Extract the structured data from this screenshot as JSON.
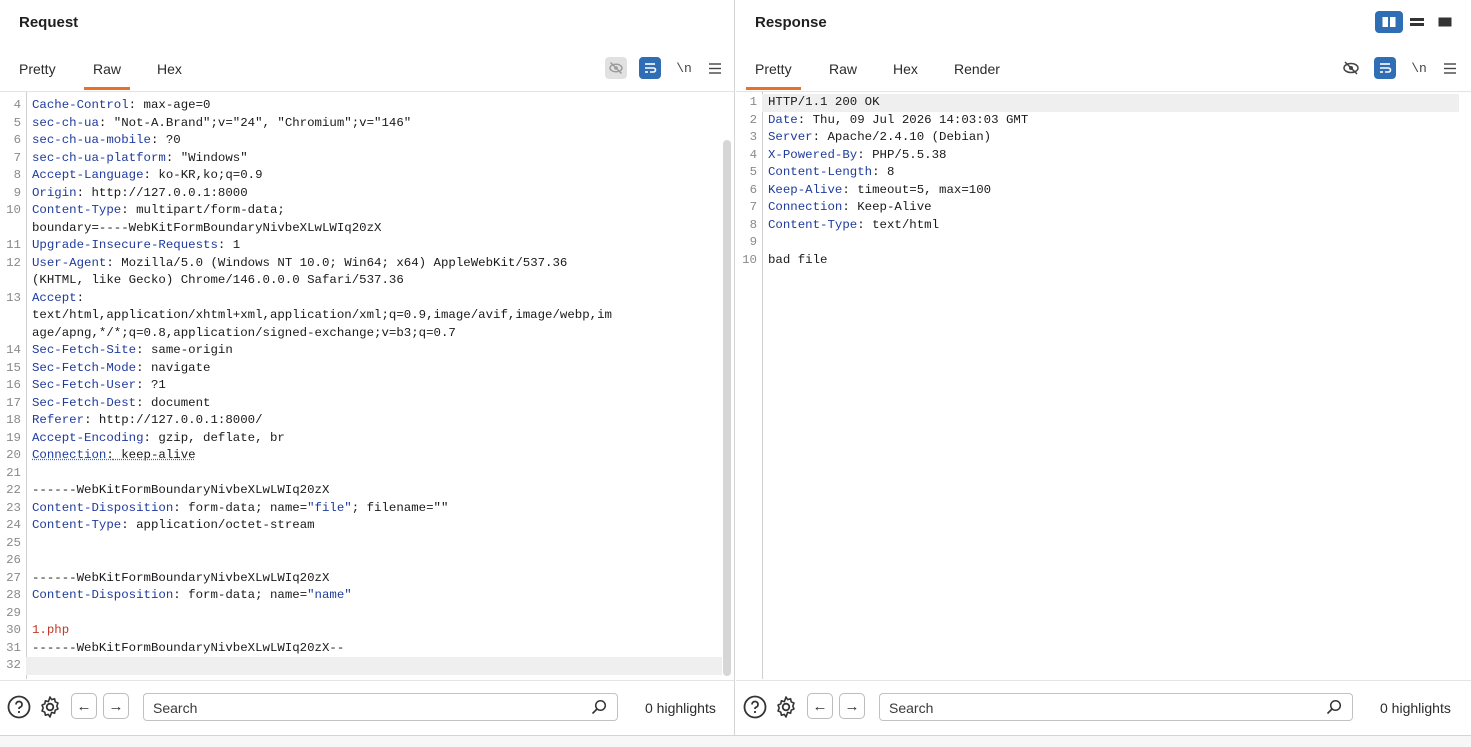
{
  "request": {
    "title": "Request",
    "tabs": [
      {
        "label": "Pretty"
      },
      {
        "label": "Raw",
        "active": true
      },
      {
        "label": "Hex"
      }
    ],
    "newline_label": "\\n",
    "lines": [
      {
        "n": "4",
        "k": "Cache-Control",
        "v": " max-age=0"
      },
      {
        "n": "5",
        "k": "sec-ch-ua",
        "v": " \"Not-A.Brand\";v=\"24\", \"Chromium\";v=\"146\""
      },
      {
        "n": "6",
        "k": "sec-ch-ua-mobile",
        "v": " ?0"
      },
      {
        "n": "7",
        "k": "sec-ch-ua-platform",
        "v": " \"Windows\""
      },
      {
        "n": "8",
        "k": "Accept-Language",
        "v": " ko-KR,ko;q=0.9"
      },
      {
        "n": "9",
        "k": "Origin",
        "v": " http://127.0.0.1:8000"
      },
      {
        "n": "10",
        "k": "Content-Type",
        "v": " multipart/form-data;"
      },
      {
        "n": "",
        "t": "boundary=----WebKitFormBoundaryNivbeXLwLWIq20zX"
      },
      {
        "n": "11",
        "k": "Upgrade-Insecure-Requests",
        "v": " 1"
      },
      {
        "n": "12",
        "k": "User-Agent",
        "v": " Mozilla/5.0 (Windows NT 10.0; Win64; x64) AppleWebKit/537.36"
      },
      {
        "n": "",
        "t": "(KHTML, like Gecko) Chrome/146.0.0.0 Safari/537.36"
      },
      {
        "n": "13",
        "k": "Accept",
        "v": ""
      },
      {
        "n": "",
        "t": "text/html,application/xhtml+xml,application/xml;q=0.9,image/avif,image/webp,im"
      },
      {
        "n": "",
        "t": "age/apng,*/*;q=0.8,application/signed-exchange;v=b3;q=0.7"
      },
      {
        "n": "14",
        "k": "Sec-Fetch-Site",
        "v": " same-origin"
      },
      {
        "n": "15",
        "k": "Sec-Fetch-Mode",
        "v": " navigate"
      },
      {
        "n": "16",
        "k": "Sec-Fetch-User",
        "v": " ?1"
      },
      {
        "n": "17",
        "k": "Sec-Fetch-Dest",
        "v": " document"
      },
      {
        "n": "18",
        "k": "Referer",
        "v": " http://127.0.0.1:8000/"
      },
      {
        "n": "19",
        "k": "Accept-Encoding",
        "v": " gzip, deflate, br"
      },
      {
        "n": "20",
        "k": "Connection",
        "v": " keep-alive",
        "dotted": true
      },
      {
        "n": "21",
        "t": ""
      },
      {
        "n": "22",
        "t": "------WebKitFormBoundaryNivbeXLwLWIq20zX"
      },
      {
        "n": "23",
        "k": "Content-Disposition",
        "v": " form-data; name=",
        "s": "\"file\"",
        "v2": "; filename=\"\""
      },
      {
        "n": "24",
        "k": "Content-Type",
        "v": " application/octet-stream"
      },
      {
        "n": "25",
        "t": ""
      },
      {
        "n": "26",
        "t": ""
      },
      {
        "n": "27",
        "t": "------WebKitFormBoundaryNivbeXLwLWIq20zX"
      },
      {
        "n": "28",
        "k": "Content-Disposition",
        "v": " form-data; name=",
        "s": "\"name\"",
        "v2": ""
      },
      {
        "n": "29",
        "t": ""
      },
      {
        "n": "30",
        "t": "1.php",
        "red": true
      },
      {
        "n": "31",
        "t": "------WebKitFormBoundaryNivbeXLwLWIq20zX--"
      },
      {
        "n": "32",
        "t": "",
        "current": true
      }
    ],
    "footer": {
      "search_placeholder": "Search",
      "highlights": "0 highlights"
    }
  },
  "response": {
    "title": "Response",
    "tabs": [
      {
        "label": "Pretty",
        "active": true
      },
      {
        "label": "Raw"
      },
      {
        "label": "Hex"
      },
      {
        "label": "Render"
      }
    ],
    "newline_label": "\\n",
    "lines": [
      {
        "n": "1",
        "t": "HTTP/1.1 200 OK",
        "current": true
      },
      {
        "n": "2",
        "k": "Date",
        "v": " Thu, 09 Jul 2026 14:03:03 GMT"
      },
      {
        "n": "3",
        "k": "Server",
        "v": " Apache/2.4.10 (Debian)"
      },
      {
        "n": "4",
        "k": "X-Powered-By",
        "v": " PHP/5.5.38"
      },
      {
        "n": "5",
        "k": "Content-Length",
        "v": " 8"
      },
      {
        "n": "6",
        "k": "Keep-Alive",
        "v": " timeout=5, max=100"
      },
      {
        "n": "7",
        "k": "Connection",
        "v": " Keep-Alive"
      },
      {
        "n": "8",
        "k": "Content-Type",
        "v": " text/html"
      },
      {
        "n": "9",
        "t": ""
      },
      {
        "n": "10",
        "t": "bad file"
      }
    ],
    "footer": {
      "search_placeholder": "Search",
      "highlights": "0 highlights"
    }
  },
  "colors": {
    "accent": "#e8702a",
    "header_key": "#1f3b9e",
    "string_value": "#c0392b",
    "toggle_blue": "#2f6db5"
  },
  "icons": [
    "help-icon",
    "settings-gear-icon",
    "arrow-left-icon",
    "arrow-right-icon",
    "search-icon",
    "hide-eye-icon",
    "wrap-text-icon",
    "menu-icon",
    "layout-split-icon"
  ]
}
